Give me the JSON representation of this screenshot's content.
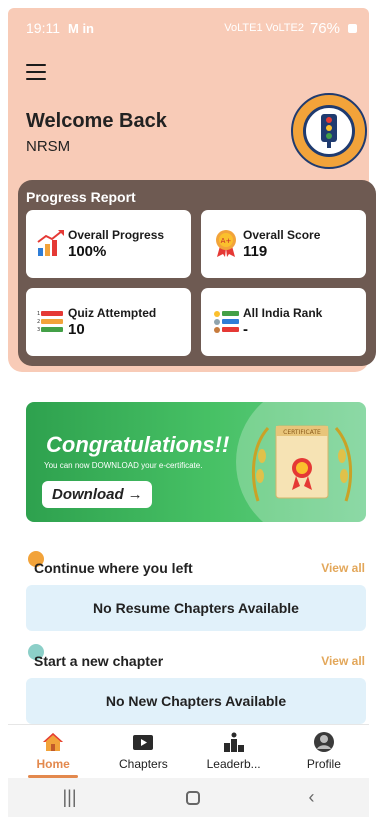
{
  "status_bar": {
    "time": "19:11",
    "left_icons": "M in",
    "signal_text": "VoLTE1 VoLTE2",
    "battery": "76%"
  },
  "header": {
    "welcome": "Welcome Back",
    "user": "NRSM"
  },
  "progress_report": {
    "title": "Progress Report",
    "cards": [
      {
        "label": "Overall Progress",
        "value": "100%"
      },
      {
        "label": "Overall Score",
        "value": "119"
      },
      {
        "label": "Quiz Attempted",
        "value": "10"
      },
      {
        "label": "All India Rank",
        "value": "-"
      }
    ]
  },
  "banner": {
    "title": "Congratulations!!",
    "subtitle": "You can now DOWNLOAD your e-certificate.",
    "button": "Download",
    "certificate_text": "CERTIFICATE"
  },
  "sections": {
    "continue": {
      "title": "Continue where you left",
      "view_all": "View all",
      "empty": "No Resume Chapters Available"
    },
    "new_chapter": {
      "title": "Start a new chapter",
      "view_all": "View all",
      "empty": "No New Chapters Available"
    }
  },
  "bottom_nav": [
    {
      "label": "Home",
      "icon": "home-icon",
      "active": true
    },
    {
      "label": "Chapters",
      "icon": "play-icon",
      "active": false
    },
    {
      "label": "Leaderb...",
      "icon": "podium-icon",
      "active": false
    },
    {
      "label": "Profile",
      "icon": "user-icon",
      "active": false
    }
  ],
  "colors": {
    "header_bg": "#f8cbb7",
    "progress_bg": "#6e5a52",
    "accent": "#e3a75a",
    "banner_green": "#2ea14e",
    "empty_box": "#e1f1fa"
  }
}
